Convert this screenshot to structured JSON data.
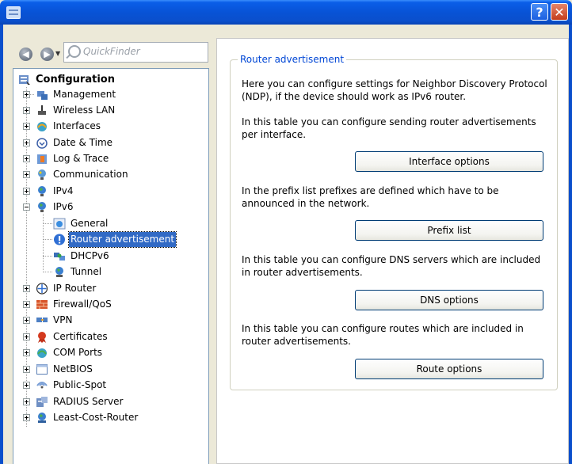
{
  "window": {
    "help_label": "?",
    "close_label": "✕"
  },
  "toolbar": {
    "back_icon": "arrow-left-icon",
    "forward_icon": "arrow-right-icon",
    "quickfinder_placeholder": "QuickFinder"
  },
  "tree": {
    "root": "Configuration",
    "items": [
      {
        "label": "Management",
        "icon": "management-icon"
      },
      {
        "label": "Wireless LAN",
        "icon": "wireless-icon"
      },
      {
        "label": "Interfaces",
        "icon": "interfaces-icon"
      },
      {
        "label": "Date & Time",
        "icon": "clock-icon"
      },
      {
        "label": "Log & Trace",
        "icon": "log-icon"
      },
      {
        "label": "Communication",
        "icon": "communication-icon"
      },
      {
        "label": "IPv4",
        "icon": "globe-icon"
      },
      {
        "label": "IPv6",
        "icon": "globe-icon"
      },
      {
        "label": "IP Router",
        "icon": "router-icon"
      },
      {
        "label": "Firewall/QoS",
        "icon": "firewall-icon"
      },
      {
        "label": "VPN",
        "icon": "vpn-icon"
      },
      {
        "label": "Certificates",
        "icon": "certificate-icon"
      },
      {
        "label": "COM Ports",
        "icon": "com-port-icon"
      },
      {
        "label": "NetBIOS",
        "icon": "netbios-icon"
      },
      {
        "label": "Public-Spot",
        "icon": "public-spot-icon"
      },
      {
        "label": "RADIUS Server",
        "icon": "radius-icon"
      },
      {
        "label": "Least-Cost-Router",
        "icon": "least-cost-router-icon"
      }
    ],
    "ipv6_children": [
      {
        "label": "General",
        "icon": "general-icon"
      },
      {
        "label": "Router advertisement",
        "icon": "info-icon",
        "selected": true
      },
      {
        "label": "DHCPv6",
        "icon": "dhcp-icon"
      },
      {
        "label": "Tunnel",
        "icon": "tunnel-icon"
      }
    ]
  },
  "panel": {
    "group_title": "Router advertisement",
    "intro": "Here you can configure settings for Neighbor Discovery Protocol (NDP), if the device should work as IPv6 router.",
    "sections": [
      {
        "text": "In this table you can configure sending router advertisements per interface.",
        "button": "Interface options"
      },
      {
        "text": "In the prefix list prefixes are defined which have to be announced in the network.",
        "button": "Prefix list"
      },
      {
        "text": "In this table you can configure DNS servers which are included in router advertisements.",
        "button": "DNS options"
      },
      {
        "text": "In this table you can configure routes which are included in router advertisements.",
        "button": "Route options"
      }
    ]
  }
}
